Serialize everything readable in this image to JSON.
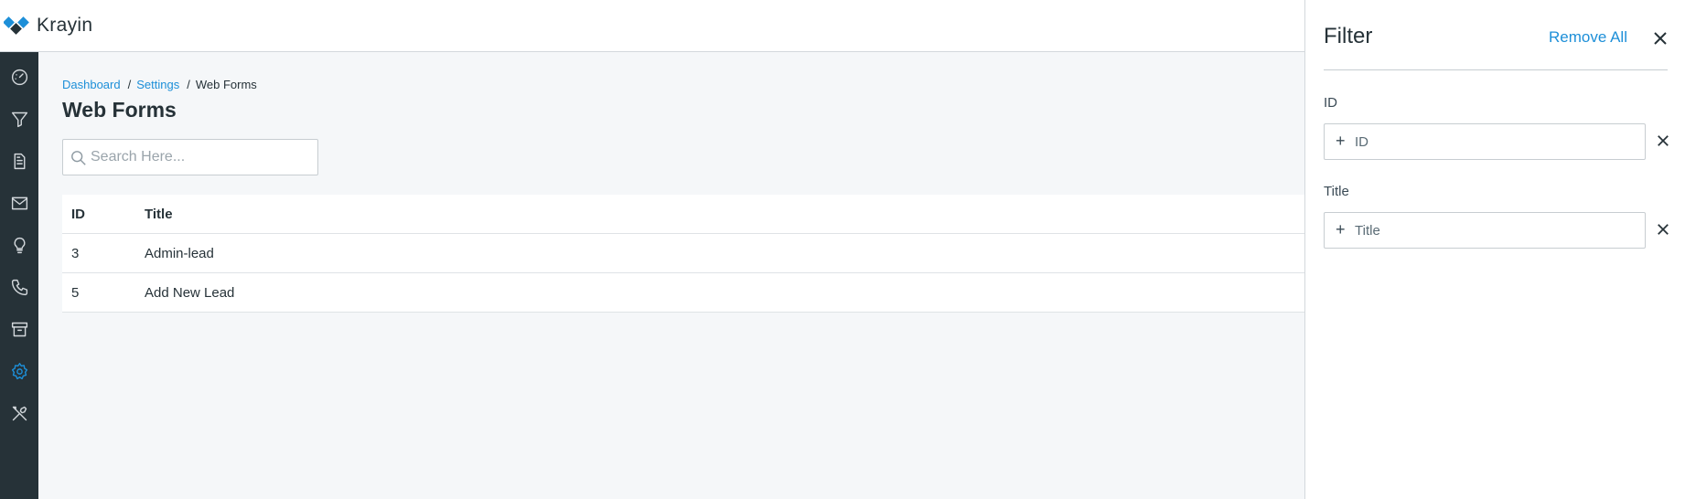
{
  "app": {
    "brand_name": "Krayin"
  },
  "colors": {
    "accent": "#1d8fd8",
    "sidebar_bg": "#263238",
    "page_bg": "#f5f7f9"
  },
  "sidebar": {
    "items": [
      {
        "icon": "dashboard-icon"
      },
      {
        "icon": "funnel-icon"
      },
      {
        "icon": "document-icon"
      },
      {
        "icon": "mail-icon"
      },
      {
        "icon": "lightbulb-icon"
      },
      {
        "icon": "phone-icon"
      },
      {
        "icon": "archive-icon"
      },
      {
        "icon": "gear-icon",
        "active": true
      },
      {
        "icon": "tools-icon"
      }
    ]
  },
  "breadcrumb": {
    "items": [
      "Dashboard",
      "Settings",
      "Web Forms"
    ],
    "separator": "/"
  },
  "page": {
    "title": "Web Forms"
  },
  "search": {
    "placeholder": "Search Here..."
  },
  "table": {
    "columns": [
      "ID",
      "Title"
    ],
    "rows": [
      {
        "id": "3",
        "title": "Admin-lead"
      },
      {
        "id": "5",
        "title": "Add New Lead"
      }
    ]
  },
  "filter_panel": {
    "title": "Filter",
    "remove_all_label": "Remove All",
    "fields": [
      {
        "label": "ID",
        "placeholder": "ID"
      },
      {
        "label": "Title",
        "placeholder": "Title"
      }
    ]
  }
}
